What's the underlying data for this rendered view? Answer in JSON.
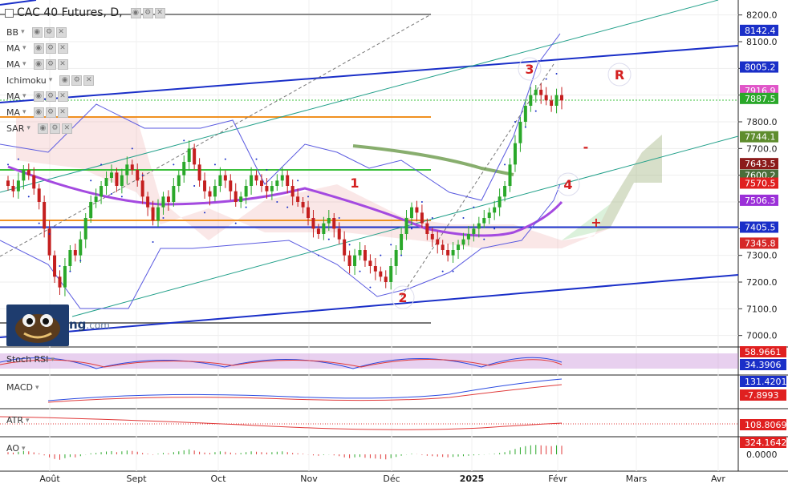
{
  "header": {
    "title": "CAC 40 Futures, D,"
  },
  "indicators": [
    "BB",
    "MA",
    "MA",
    "Ichimoku",
    "MA",
    "MA",
    "SAR"
  ],
  "subpanels": {
    "stoch": "Stoch RSI",
    "macd": "MACD",
    "atr": "ATR",
    "ao": "AO"
  },
  "logo": {
    "text": "ng",
    "suffix": ".com"
  },
  "chart_data": {
    "type": "candlestick",
    "title": "CAC 40 Futures, D,",
    "x_ticks": [
      "Août",
      "Sept",
      "Oct",
      "Nov",
      "Déc",
      "2025",
      "Févr",
      "Mars",
      "Avr"
    ],
    "y_ticks": [
      8200.0,
      8100.0,
      8000.0,
      7900.0,
      7800.0,
      7700.0,
      7600.0,
      7500.0,
      7400.0,
      7300.0,
      7200.0,
      7100.0,
      7000.0
    ],
    "ylim": [
      6960,
      8250
    ],
    "price_labels": [
      {
        "value": "8142.4",
        "color": "#1a2fc8"
      },
      {
        "value": "8005.2",
        "color": "#1a2fc8"
      },
      {
        "value": "7916.9",
        "color": "#e056c8"
      },
      {
        "value": "7887.5",
        "color": "#2aa82a"
      },
      {
        "value": "7744.1",
        "color": "#5e8d2e"
      },
      {
        "value": "7643.5",
        "color": "#8b1a1a"
      },
      {
        "value": "7600.2",
        "color": "#4a6e3a"
      },
      {
        "value": "7570.5",
        "color": "#e02020"
      },
      {
        "value": "7506.3",
        "color": "#9b30d8"
      },
      {
        "value": "7405.5",
        "color": "#1a2fc8"
      },
      {
        "value": "7345.8",
        "color": "#d62828"
      }
    ],
    "annotations": [
      "1",
      "2",
      "3",
      "4",
      "R",
      "-",
      "+"
    ],
    "closes": [
      7560,
      7540,
      7580,
      7620,
      7600,
      7550,
      7500,
      7400,
      7300,
      7220,
      7180,
      7260,
      7320,
      7300,
      7360,
      7440,
      7500,
      7520,
      7560,
      7590,
      7610,
      7560,
      7600,
      7640,
      7620,
      7580,
      7520,
      7480,
      7430,
      7480,
      7520,
      7500,
      7560,
      7600,
      7650,
      7700,
      7640,
      7580,
      7540,
      7520,
      7560,
      7600,
      7580,
      7540,
      7500,
      7520,
      7560,
      7600,
      7580,
      7560,
      7540,
      7560,
      7580,
      7600,
      7560,
      7520,
      7500,
      7480,
      7440,
      7400,
      7380,
      7420,
      7440,
      7400,
      7360,
      7300,
      7260,
      7300,
      7320,
      7280,
      7260,
      7240,
      7220,
      7200,
      7260,
      7320,
      7380,
      7440,
      7480,
      7460,
      7420,
      7380,
      7360,
      7340,
      7320,
      7300,
      7320,
      7340,
      7360,
      7380,
      7400,
      7420,
      7440,
      7460,
      7480,
      7520,
      7560,
      7640,
      7720,
      7800,
      7860,
      7900,
      7920,
      7900,
      7880,
      7860,
      7900,
      7880
    ],
    "sub_labels": {
      "stoch": [
        "58.9661",
        "34.3906"
      ],
      "macd": [
        "131.4201",
        "-7.8993"
      ],
      "atr": [
        "108.8069"
      ],
      "ao": [
        "324.1642",
        "0.0000"
      ]
    }
  }
}
